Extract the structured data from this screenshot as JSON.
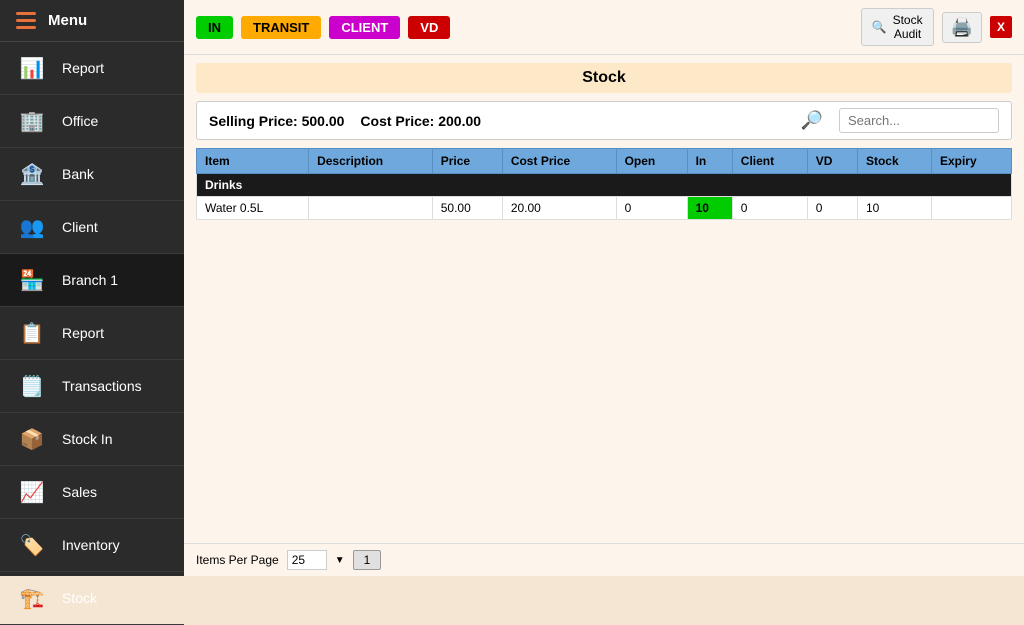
{
  "sidebar": {
    "menu_label": "Menu",
    "items": [
      {
        "id": "report",
        "label": "Report",
        "icon": "📊"
      },
      {
        "id": "office",
        "label": "Office",
        "icon": "🏢"
      },
      {
        "id": "bank",
        "label": "Bank",
        "icon": "🏦"
      },
      {
        "id": "client",
        "label": "Client",
        "icon": "👥"
      },
      {
        "id": "branch",
        "label": "Branch 1",
        "icon": "🏪"
      },
      {
        "id": "report2",
        "label": "Report",
        "icon": "📋"
      },
      {
        "id": "transactions",
        "label": "Transactions",
        "icon": "🗒️"
      },
      {
        "id": "stock_in",
        "label": "Stock In",
        "icon": "📦"
      },
      {
        "id": "sales",
        "label": "Sales",
        "icon": "📈"
      },
      {
        "id": "inventory",
        "label": "Inventory",
        "icon": "🏷️"
      },
      {
        "id": "stock",
        "label": "Stock",
        "icon": "🏗️"
      }
    ]
  },
  "topbar": {
    "badges": [
      {
        "id": "in",
        "label": "IN",
        "class": "badge-in"
      },
      {
        "id": "transit",
        "label": "TRANSIT",
        "class": "badge-transit"
      },
      {
        "id": "client",
        "label": "CLIENT",
        "class": "badge-client"
      },
      {
        "id": "vd",
        "label": "VD",
        "class": "badge-vd"
      }
    ],
    "stock_audit_label": "Stock\nAudit",
    "close_label": "X"
  },
  "main": {
    "section_title": "Stock",
    "selling_price_label": "Selling Price: 500.00",
    "cost_price_label": "Cost Price: 200.00",
    "search_placeholder": "Search...",
    "table": {
      "columns": [
        "Item",
        "Description",
        "Price",
        "Cost Price",
        "Open",
        "In",
        "Client",
        "VD",
        "Stock",
        "Expiry"
      ],
      "groups": [
        {
          "name": "Drinks",
          "rows": [
            {
              "item": "Water 0.5L",
              "description": "",
              "price": "50.00",
              "cost_price": "20.00",
              "open": "0",
              "in": "10",
              "client": "0",
              "vd": "0",
              "stock": "10",
              "expiry": "",
              "in_highlight": true
            }
          ]
        }
      ]
    },
    "footer": {
      "items_per_page_label": "Items Per Page",
      "per_page_value": "25",
      "page_number": "1"
    }
  }
}
